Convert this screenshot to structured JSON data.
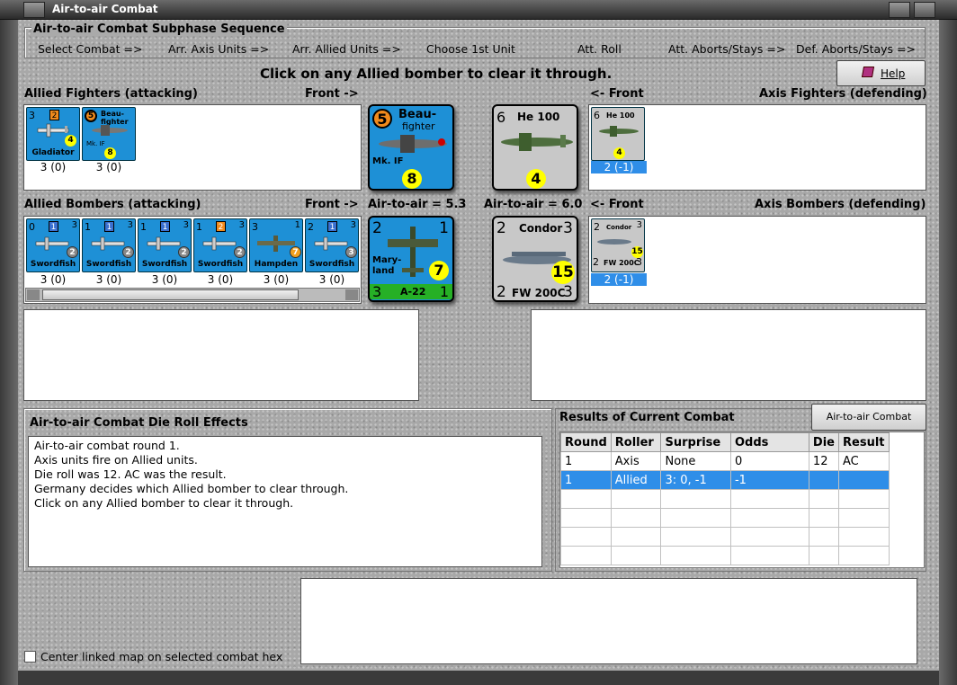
{
  "window": {
    "title": "Air-to-air Combat"
  },
  "sequence": {
    "title": "Air-to-air Combat Subphase Sequence",
    "steps": [
      "Select Combat =>",
      "Arr. Axis Units =>",
      "Arr. Allied Units =>",
      "Choose 1st Unit",
      "Att. Roll",
      "Att. Aborts/Stays =>",
      "Def. Aborts/Stays =>"
    ]
  },
  "instruction": "Click on any Allied bomber to clear it through.",
  "help_label": "Help",
  "allied_fighters": {
    "title": "Allied Fighters (attacking)",
    "front": "Front ->",
    "units": [
      {
        "name": "Gladiator",
        "top_left": "3",
        "square": "2",
        "circle": "4",
        "value": "3 (0)"
      },
      {
        "name": "Beau-fighter",
        "sub": "Mk. IF",
        "square": "5",
        "circle": "8",
        "value": "3 (0)"
      }
    ]
  },
  "allied_bombers": {
    "title": "Allied Bombers (attacking)",
    "front": "Front ->",
    "units": [
      {
        "name": "Swordfish",
        "left": "0",
        "square": "1",
        "right": "3",
        "circle": "2",
        "value": "3 (0)"
      },
      {
        "name": "Swordfish",
        "left": "1",
        "square": "1",
        "right": "3",
        "circle": "2",
        "value": "3 (0)"
      },
      {
        "name": "Swordfish",
        "left": "1",
        "square": "1",
        "right": "3",
        "circle": "2",
        "value": "3 (0)"
      },
      {
        "name": "Swordfish",
        "left": "1",
        "square": "2",
        "right": "3",
        "circle": "2",
        "value": "3 (0)"
      },
      {
        "name": "Hampden",
        "left": "3",
        "square": "",
        "right": "1",
        "circle": "7",
        "value": "3 (0)"
      },
      {
        "name": "Swordfish",
        "left": "2",
        "square": "1",
        "right": "3",
        "circle": "3",
        "value": "3 (0)"
      }
    ]
  },
  "center": {
    "fighter_allied": {
      "num": "5",
      "name1": "Beau-",
      "name2": "fighter",
      "sub": "Mk. IF",
      "circle": "8"
    },
    "fighter_axis": {
      "num": "6",
      "name": "He 100",
      "circle": "4"
    },
    "allied_air": "Air-to-air = 5.3",
    "axis_air": "Air-to-air = 6.0",
    "bomber_allied": {
      "tl": "2",
      "tr": "1",
      "name1": "Mary-",
      "name2": "land",
      "circle": "7",
      "bl": "3",
      "code": "A-22",
      "br": "1"
    },
    "bomber_axis": {
      "tl": "2",
      "name": "Condor",
      "tr": "3",
      "circle": "15",
      "bl": "2",
      "code": "FW 200C",
      "br": "3"
    }
  },
  "axis_fighters": {
    "title": "Axis Fighters (defending)",
    "front": "<- Front",
    "units": [
      {
        "name": "He 100",
        "top_left": "6",
        "circle": "4",
        "value": "2 (-1)"
      }
    ]
  },
  "axis_bombers": {
    "title": "Axis Bombers (defending)",
    "front": "<- Front",
    "units": [
      {
        "name": "Condor",
        "code": "FW 200C",
        "tl": "2",
        "tr": "3",
        "bl": "2",
        "br": "3",
        "circle": "15",
        "value": "2 (-1)"
      }
    ]
  },
  "die_effects": {
    "title": "Air-to-air Combat Die Roll Effects",
    "lines": [
      "Air-to-air combat round 1.",
      "Axis units fire on Allied units.",
      "Die roll was 12.  AC was the result.",
      "Germany decides which Allied bomber to clear through.",
      "Click on any Allied bomber to clear it through."
    ]
  },
  "results": {
    "title": "Results of Current Combat",
    "chart_button": "Air-to-air Combat Chart",
    "headers": [
      "Round",
      "Roller",
      "Surprise",
      "Odds",
      "Die",
      "Result"
    ],
    "rows": [
      [
        "1",
        "Axis",
        "None",
        "0",
        "12",
        "AC"
      ],
      [
        "1",
        "Allied",
        "3: 0, -1",
        "-1",
        "",
        ""
      ]
    ]
  },
  "center_map_label": "Center linked map on selected combat hex",
  "colors": {
    "allied_counter": "#1e90d6",
    "axis_counter": "#c8c8c8",
    "selected_row": "#2f8ee8"
  }
}
